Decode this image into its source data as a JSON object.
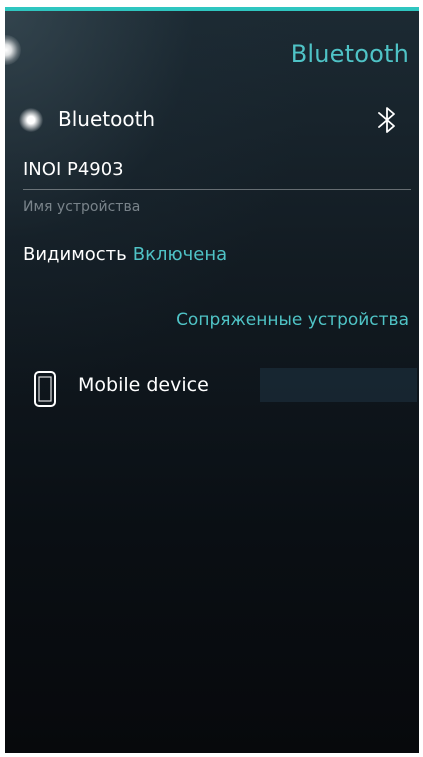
{
  "header": {
    "title": "Bluetooth"
  },
  "bluetooth": {
    "label": "Bluetooth",
    "enabled": true,
    "icon": "bluetooth-icon"
  },
  "device_name": {
    "value": "INOI P4903",
    "caption": "Имя устройства"
  },
  "visibility": {
    "label": "Видимость",
    "value": "Включена"
  },
  "paired_section": {
    "title": "Сопряженные устройства",
    "devices": [
      {
        "name": "Mobile device",
        "icon": "phone-icon"
      }
    ]
  },
  "colors": {
    "accent": "#2fc6c0",
    "highlight_text": "#4fc3c6",
    "background": "#0a0f14"
  }
}
